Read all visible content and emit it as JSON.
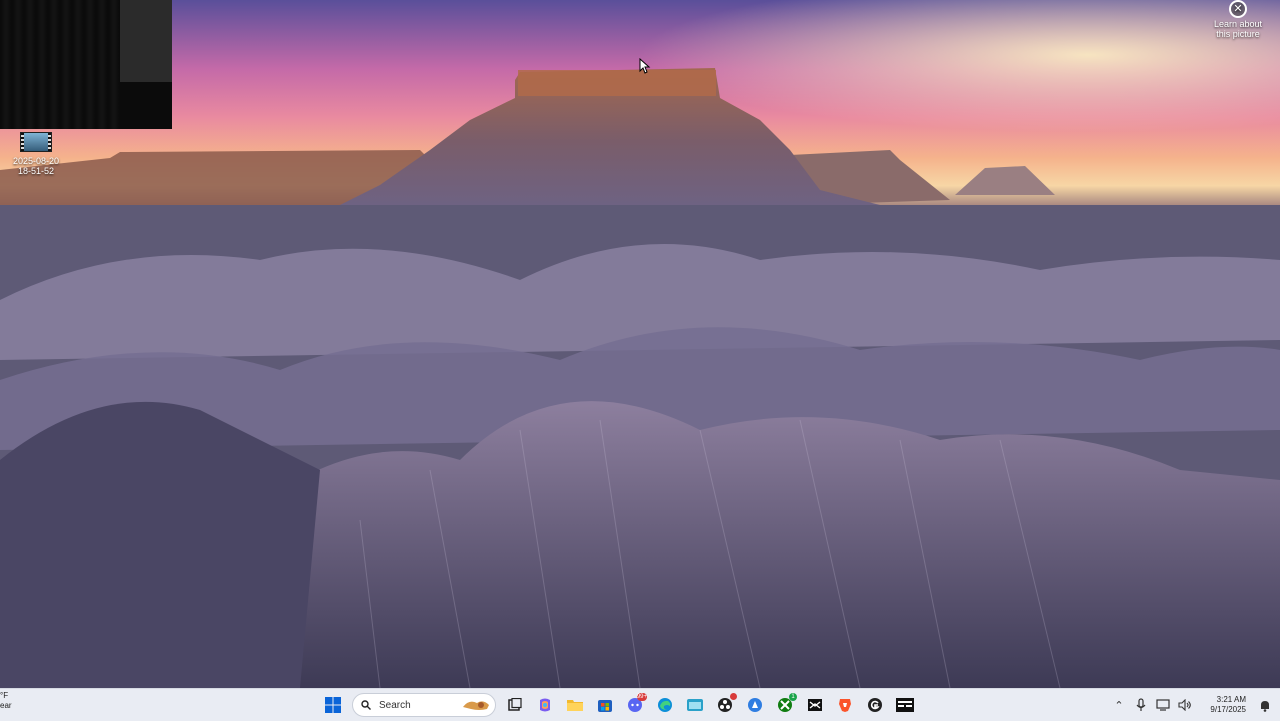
{
  "desktop": {
    "icon": {
      "label_line1": "2025-08-20",
      "label_line2": "18-51-52"
    },
    "learn_about": {
      "line1": "Learn about",
      "line2": "this picture"
    }
  },
  "taskbar": {
    "weather": {
      "temp": "°F",
      "condition": "ear"
    },
    "search": {
      "placeholder": "Search"
    },
    "apps": [
      {
        "name": "start",
        "icon": "windows-logo-icon"
      },
      {
        "name": "task-view",
        "icon": "task-view-icon"
      },
      {
        "name": "copilot",
        "icon": "copilot-icon"
      },
      {
        "name": "file-explorer",
        "icon": "folder-icon"
      },
      {
        "name": "store",
        "icon": "store-icon"
      },
      {
        "name": "chat",
        "icon": "chat-bubble-icon",
        "badge": "99+"
      },
      {
        "name": "edge",
        "icon": "edge-icon"
      },
      {
        "name": "files",
        "icon": "files-icon"
      },
      {
        "name": "obs",
        "icon": "record-icon"
      },
      {
        "name": "app-blue",
        "icon": "blue-app-icon"
      },
      {
        "name": "xbox",
        "icon": "xbox-icon",
        "badge": "1"
      },
      {
        "name": "capcut",
        "icon": "capcut-icon"
      },
      {
        "name": "brave",
        "icon": "brave-lion-icon"
      },
      {
        "name": "g-app",
        "icon": "g-app-icon"
      },
      {
        "name": "terminal",
        "icon": "terminal-icon"
      }
    ],
    "clock": {
      "time": "3:21 AM",
      "date": "9/17/2025"
    }
  },
  "colors": {
    "taskbar_bg": "#e9ecf3",
    "accent_blue": "#0a64d8",
    "badge_red": "#d83b3b",
    "badge_green": "#1aa34a"
  }
}
